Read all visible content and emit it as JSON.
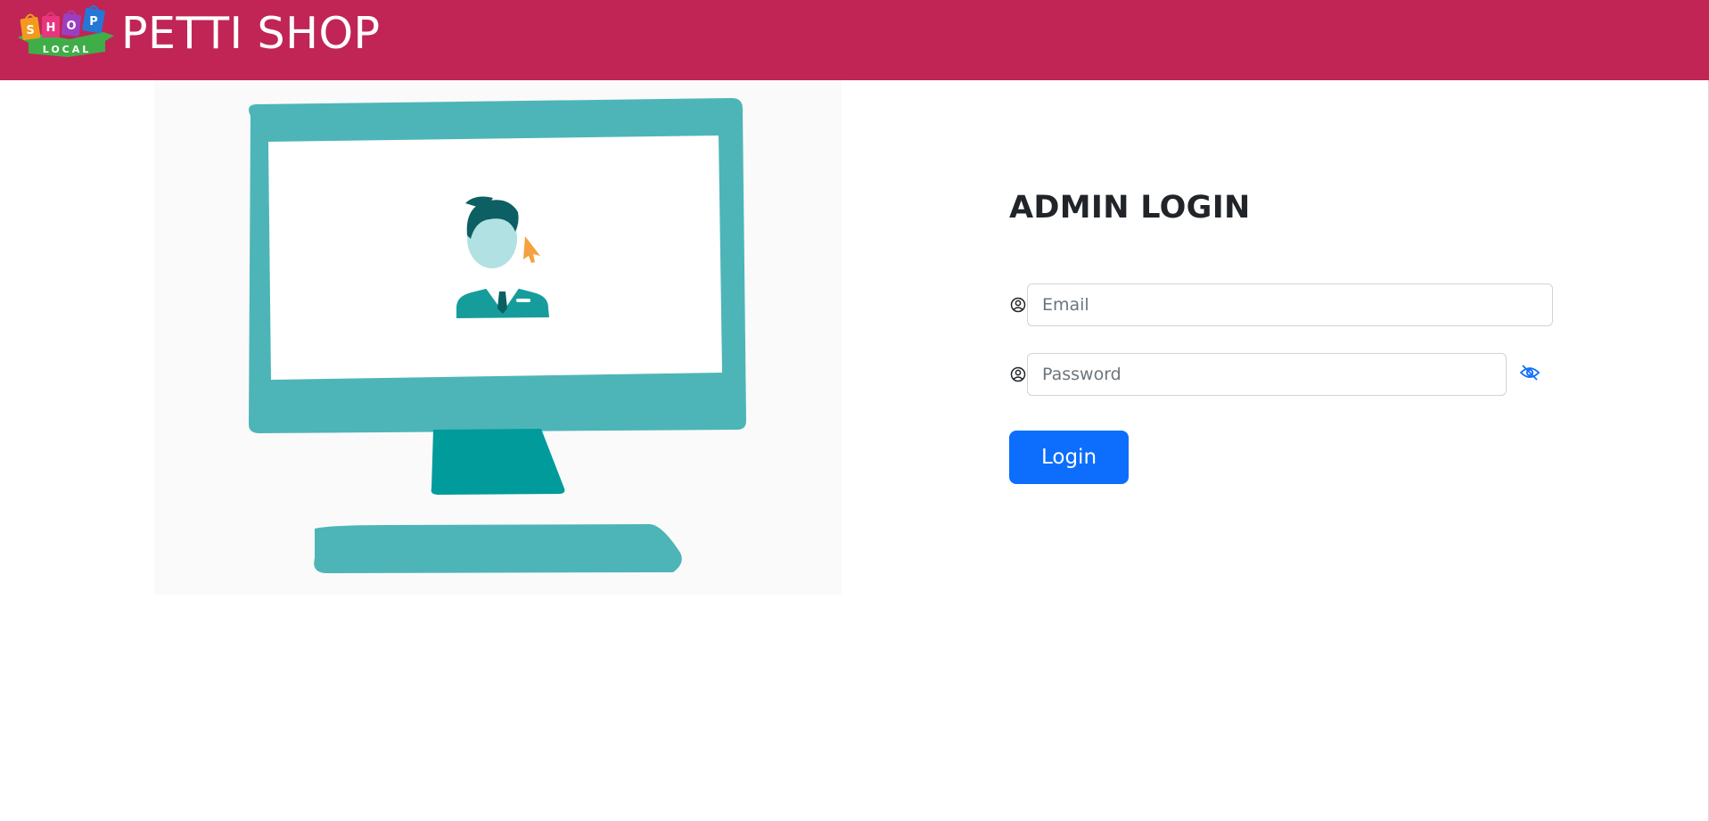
{
  "header": {
    "brand_title": "PETTI SHOP",
    "logo_text": "SHOP LOCAL",
    "logo_bag_letters": [
      "S",
      "H",
      "O",
      "P"
    ],
    "logo_ribbon_text": "LOCAL",
    "background_color": "#c02556"
  },
  "illustration": {
    "icon": "admin-at-computer-illustration"
  },
  "login": {
    "title": "ADMIN LOGIN",
    "email_placeholder": "Email",
    "email_icon": "user-circle-icon",
    "password_placeholder": "Password",
    "password_icon": "user-circle-icon",
    "toggle_icon": "eye-slash-icon",
    "button_label": "Login",
    "button_color": "#0d6efd"
  }
}
